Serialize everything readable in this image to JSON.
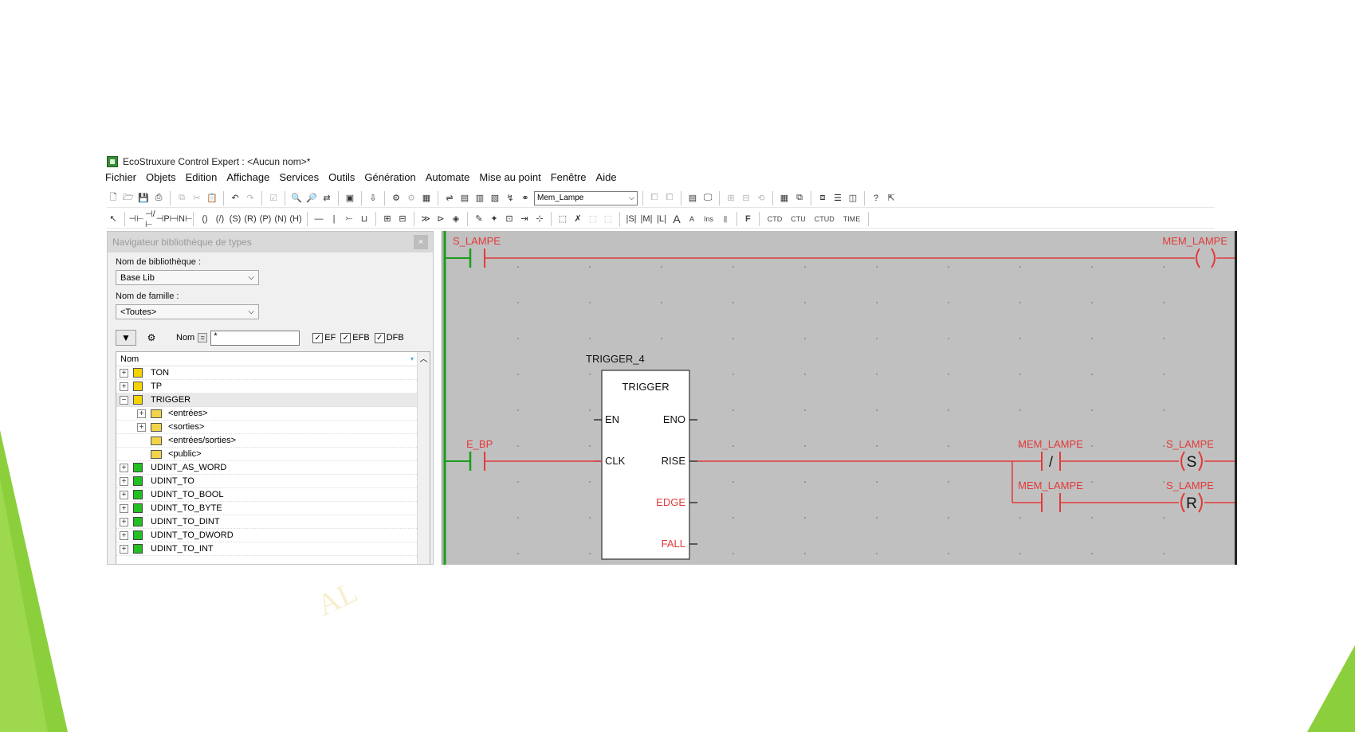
{
  "window": {
    "title": "EcoStruxure Control Expert : <Aucun nom>*"
  },
  "menu": [
    "Fichier",
    "Objets",
    "Edition",
    "Affichage",
    "Services",
    "Outils",
    "Génération",
    "Automate",
    "Mise au point",
    "Fenêtre",
    "Aide"
  ],
  "toolbar": {
    "search_value": "Mem_Lampe",
    "ins_label": "Ins",
    "f_label": "F",
    "ctd_label": "CTD",
    "ctu_label": "CTU",
    "ctud_label": "CTUD",
    "time_label": "TIME"
  },
  "navigator": {
    "title": "Navigateur bibliothèque de types",
    "library_label": "Nom de bibliothèque :",
    "library_value": "Base Lib",
    "family_label": "Nom de famille :",
    "family_value": "<Toutes>",
    "nom_label": "Nom",
    "nom_value": "*",
    "checks": [
      "EF",
      "EFB",
      "DFB"
    ],
    "tree_header": "Nom",
    "items": [
      {
        "label": "TON",
        "type": "fb",
        "expander": "+",
        "indent": 0
      },
      {
        "label": "TP",
        "type": "fb",
        "expander": "+",
        "indent": 0
      },
      {
        "label": "TRIGGER",
        "type": "fb",
        "expander": "−",
        "indent": 0
      },
      {
        "label": "<entrées>",
        "type": "folder",
        "expander": "+",
        "indent": 1
      },
      {
        "label": "<sorties>",
        "type": "folder",
        "expander": "+",
        "indent": 1
      },
      {
        "label": "<entrées/sorties>",
        "type": "folder",
        "expander": "",
        "indent": 1
      },
      {
        "label": "<public>",
        "type": "folder",
        "expander": "",
        "indent": 1
      },
      {
        "label": "UDINT_AS_WORD",
        "type": "fn",
        "expander": "+",
        "indent": 0
      },
      {
        "label": "UDINT_TO",
        "type": "fn",
        "expander": "+",
        "indent": 0
      },
      {
        "label": "UDINT_TO_BOOL",
        "type": "fn",
        "expander": "+",
        "indent": 0
      },
      {
        "label": "UDINT_TO_BYTE",
        "type": "fn",
        "expander": "+",
        "indent": 0
      },
      {
        "label": "UDINT_TO_DINT",
        "type": "fn",
        "expander": "+",
        "indent": 0
      },
      {
        "label": "UDINT_TO_DWORD",
        "type": "fn",
        "expander": "+",
        "indent": 0
      },
      {
        "label": "UDINT_TO_INT",
        "type": "fn",
        "expander": "+",
        "indent": 0
      }
    ]
  },
  "ladder": {
    "rung1": {
      "contact": "S_LAMPE",
      "coil": "MEM_LAMPE"
    },
    "fb_instance": "TRIGGER_4",
    "fb_type": "TRIGGER",
    "pins": {
      "en": "EN",
      "eno": "ENO",
      "clk": "CLK",
      "rise": "RISE",
      "edge": "EDGE",
      "fall": "FALL"
    },
    "rung2": {
      "contact": "E_BP",
      "contact_nc": "MEM_LAMPE",
      "nc_symbol": "/",
      "coil_set": "S_LAMPE",
      "set_symbol": "S",
      "contact_no": "MEM_LAMPE",
      "coil_reset": "S_LAMPE",
      "reset_symbol": "R"
    }
  },
  "colors": {
    "ladder_red": "#e23a3a",
    "rail_green": "#1a9e1a",
    "editor_bg": "#c0c0c0",
    "deco_green": "#8ccf3c"
  },
  "watermark": "AL"
}
